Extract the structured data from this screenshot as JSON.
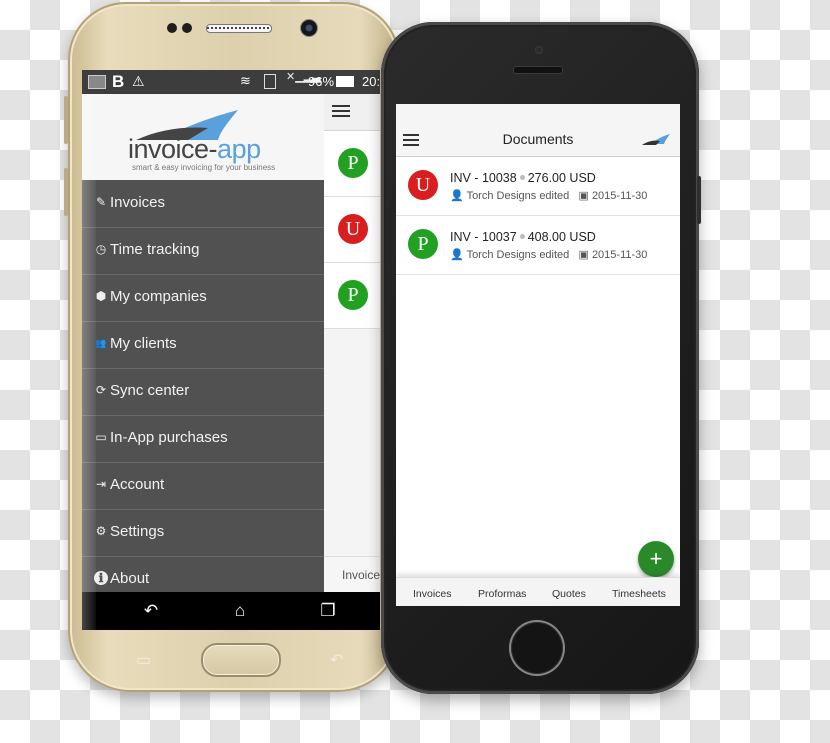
{
  "android_phone": {
    "status_bar": {
      "left_icons": [
        "keyboard-icon",
        "b-app-icon",
        "warning-icon"
      ],
      "right_icons": [
        "wifi-icon",
        "sim-alert-icon",
        "no-signal-icon"
      ],
      "battery_text": "96%",
      "time_partial": "20:"
    },
    "logo": {
      "brand_dark": "invoice",
      "brand_light": "app",
      "tagline": "smart & easy invoicing for your business"
    },
    "menu": [
      {
        "label": "Invoices",
        "icon": "edit-icon",
        "glyph": "✎"
      },
      {
        "label": "Time tracking",
        "icon": "clock-icon",
        "glyph": "◷"
      },
      {
        "label": "My companies",
        "icon": "cube-icon",
        "glyph": "⬢"
      },
      {
        "label": "My clients",
        "icon": "users-icon",
        "glyph": "👥"
      },
      {
        "label": "Sync center",
        "icon": "sync-icon",
        "glyph": "⟳"
      },
      {
        "label": "In-App purchases",
        "icon": "credit-card-icon",
        "glyph": "▭"
      },
      {
        "label": "Account",
        "icon": "sign-in-icon",
        "glyph": "⇥"
      },
      {
        "label": "Settings",
        "icon": "gear-icon",
        "glyph": "⚙"
      },
      {
        "label": "About",
        "icon": "info-icon",
        "glyph": "ℹ"
      }
    ],
    "background_list": {
      "avatars": [
        {
          "letter": "P",
          "color": "#22a022"
        },
        {
          "letter": "U",
          "color": "#d81e1e"
        },
        {
          "letter": "P",
          "color": "#22a022"
        }
      ],
      "tab_label_partial": "Invoice"
    },
    "nav_bar": {
      "back": "↶",
      "home": "⌂",
      "recents": "❐"
    }
  },
  "iphone": {
    "header": {
      "title": "Documents"
    },
    "documents": [
      {
        "status_letter": "U",
        "status_color": "#d81e1e",
        "number": "INV - 10038",
        "amount": "276.00 USD",
        "client_text": "Torch Designs edited",
        "date": "2015-11-30"
      },
      {
        "status_letter": "P",
        "status_color": "#22a022",
        "number": "INV - 10037",
        "amount": "408.00 USD",
        "client_text": "Torch Designs edited",
        "date": "2015-11-30"
      }
    ],
    "fab_label": "+",
    "tabs": [
      "Invoices",
      "Proformas",
      "Quotes",
      "Timesheets"
    ]
  },
  "colors": {
    "drawer_bg": "#515151",
    "brand_blue": "#5aa0dc",
    "fab_green": "#2a8a2a"
  }
}
